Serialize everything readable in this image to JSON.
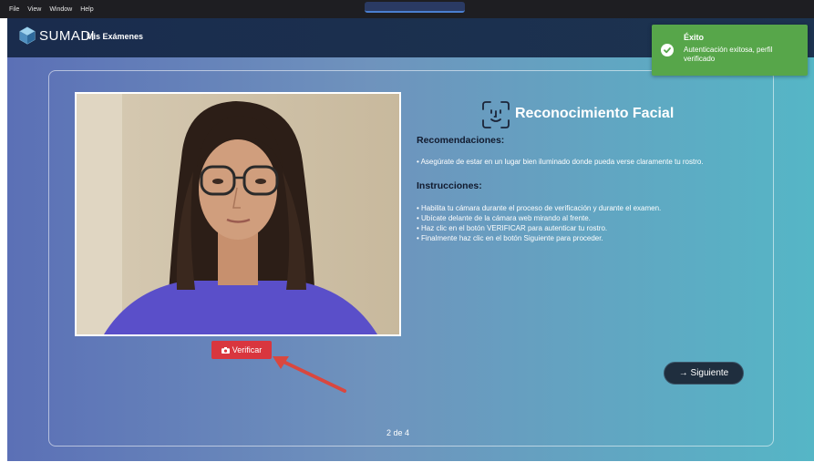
{
  "menubar": {
    "items": [
      "File",
      "View",
      "Window",
      "Help"
    ]
  },
  "header": {
    "brand": "SUMADI",
    "nav_link": "Mis Exámenes"
  },
  "toast": {
    "title": "Éxito",
    "message": "Autenticación exitosa, perfil verificado",
    "color": "#57a64a"
  },
  "camera": {
    "verify_label": "Verificar",
    "verify_color": "#d9363e"
  },
  "content": {
    "title": "Reconocimiento Facial",
    "recommendations_title": "Recomendaciones:",
    "recommendation": "• Asegúrate de estar en un lugar bien iluminado donde pueda verse claramente tu rostro.",
    "instructions_title": "Instrucciones:",
    "instructions": [
      "• Habilita tu cámara durante el proceso de verificación y durante el examen.",
      "• Ubícate delante de la cámara web mirando al frente.",
      "• Haz clic en el botón VERIFICAR para autenticar tu rostro.",
      "• Finalmente haz clic en el botón Siguiente para proceder."
    ],
    "next_label": "→ Siguiente"
  },
  "footer": {
    "step": "2 de 4"
  },
  "icons": {
    "logo": "sumadi-logo",
    "toast": "check-circle-icon",
    "face": "face-scan-icon",
    "camera": "camera-icon",
    "next": "arrow-right-icon"
  }
}
